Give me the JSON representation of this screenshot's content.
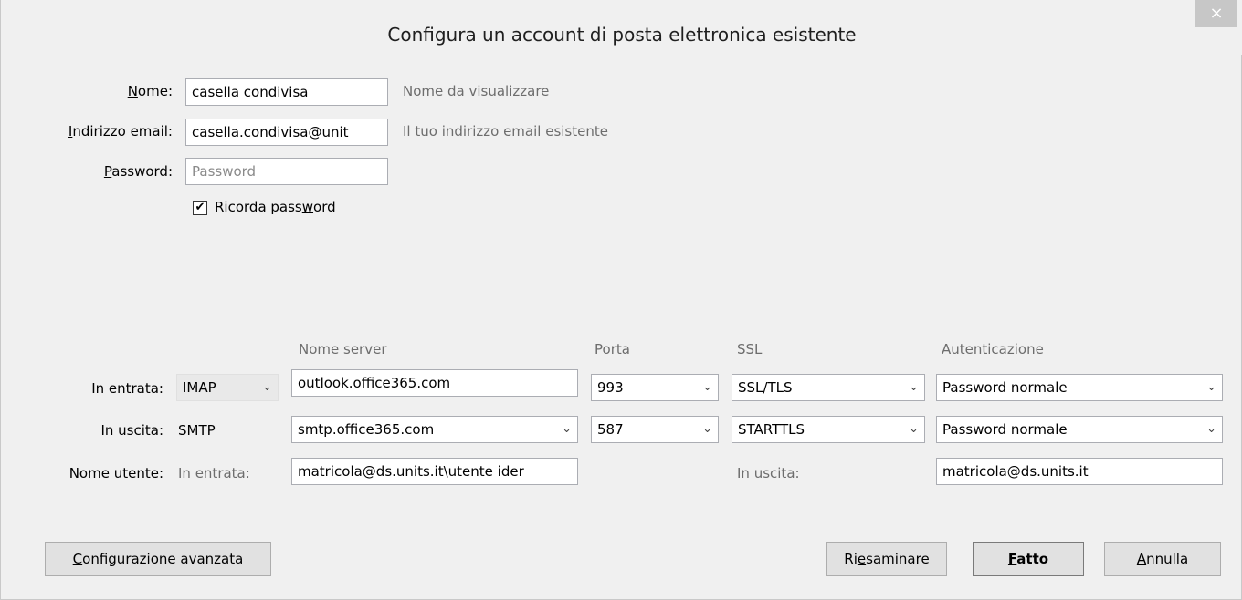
{
  "window": {
    "title": "Configura un account di posta elettronica esistente",
    "close_glyph": "×"
  },
  "form": {
    "name_label_u": "N",
    "name_label_rest": "ome:",
    "name_value": "casella condivisa",
    "name_hint": "Nome da visualizzare",
    "email_label_u": "I",
    "email_label_rest": "ndirizzo email:",
    "email_value": "casella.condivisa@unit",
    "email_hint": "Il tuo indirizzo email esistente",
    "password_label_u": "P",
    "password_label_rest": "assword:",
    "password_placeholder": "Password",
    "remember_pre": "Ricorda pass",
    "remember_u": "w",
    "remember_post": "ord",
    "remember_checked": true
  },
  "server": {
    "headers": {
      "server": "Nome server",
      "port": "Porta",
      "ssl": "SSL",
      "auth": "Autenticazione"
    },
    "incoming": {
      "label": "In entrata:",
      "protocol": "IMAP",
      "server": "outlook.office365.com",
      "port": "993",
      "ssl": "SSL/TLS",
      "auth": "Password normale"
    },
    "outgoing": {
      "label": "In uscita:",
      "protocol": "SMTP",
      "server": "smtp.office365.com",
      "port": "587",
      "ssl": "STARTTLS",
      "auth": "Password normale"
    },
    "username": {
      "label": "Nome utente:",
      "in_label": "In entrata:",
      "in_value": "matricola@ds.units.it\\utente ider",
      "out_label": "In uscita:",
      "out_value": "matricola@ds.units.it"
    }
  },
  "buttons": {
    "advanced_u": "C",
    "advanced_rest": "onfigurazione avanzata",
    "review_pre": "Ri",
    "review_u": "e",
    "review_post": "saminare",
    "done_u": "F",
    "done_rest": "atto",
    "cancel_u": "A",
    "cancel_rest": "nnulla"
  },
  "icons": {
    "chevron": "chevron-down-icon",
    "check": "checkmark-icon"
  }
}
